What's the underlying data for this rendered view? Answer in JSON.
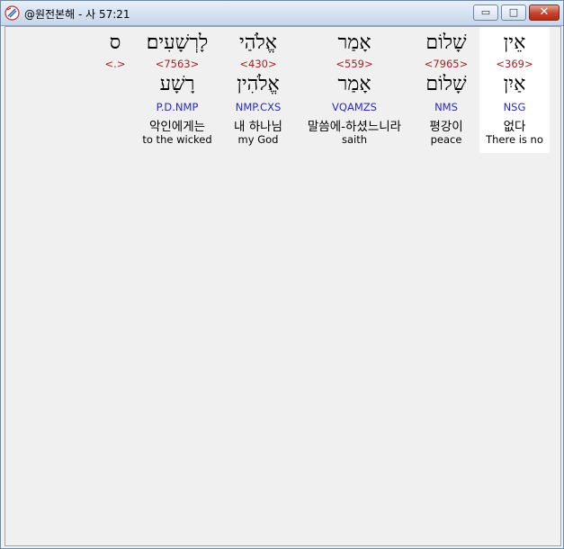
{
  "window": {
    "title": "@원전본해 - 사 57:21",
    "controls": {
      "minimize": "▭",
      "maximize": "□",
      "close": "✕"
    }
  },
  "words": [
    {
      "heb": "אֵין",
      "strong": "<369>",
      "lemma": "אַיִן",
      "parse": "NSG",
      "korean": "없다",
      "english": "There is no"
    },
    {
      "heb": "שָׁלוֹם",
      "strong": "<7965>",
      "lemma": "שָׁלוֹם",
      "parse": "NMS",
      "korean": "평강이",
      "english": "peace"
    },
    {
      "heb": "אָמַר",
      "strong": "<559>",
      "lemma": "אָמַר",
      "parse": "VQAMZS",
      "korean": "말씀에-하셨느니라",
      "english": "saith"
    },
    {
      "heb": "אֱלֹהַי",
      "strong": "<430>",
      "lemma": "אֱלֹהִין",
      "parse": "NMP.CXS",
      "korean": "내 하나님",
      "english": "my God"
    },
    {
      "heb": "לָרְשָׁעִים׃",
      "strong": "<7563>",
      "lemma": "רָשָׁע",
      "parse": "P.D.NMP",
      "korean": "악인에게는",
      "english": "to the wicked"
    },
    {
      "heb": "ס",
      "strong": "<.>",
      "lemma": "",
      "parse": "",
      "korean": "",
      "english": ""
    }
  ],
  "colors": {
    "strong": "#a02222",
    "parse": "#2a2ab8",
    "highlight": "#ffffff"
  }
}
